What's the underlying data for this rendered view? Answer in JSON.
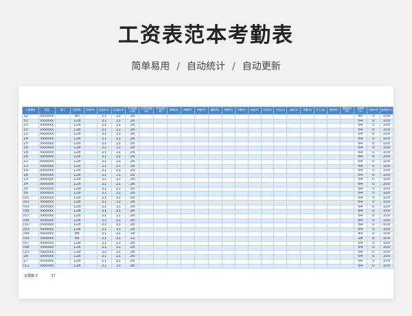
{
  "header": {
    "title": "工资表范本考勤表",
    "subtitle_items": [
      "简单易用",
      "自动统计",
      "自动更新"
    ],
    "separator": "/"
  },
  "table": {
    "columns": [
      "入职编号",
      "姓名",
      "部门",
      "应到(时)",
      "实到(时)",
      "应出勤(天)",
      "实出勤(天)",
      "平均出勤(小时)",
      "工作日加班(时)",
      "节日加班(时)",
      "事假(时)",
      "病假(时)",
      "年假(时)",
      "婚假(时)",
      "丧假(时)",
      "产假(时)",
      "出差(时)",
      "外出(时)",
      "外出(天)",
      "迟到(次)",
      "早退(次)",
      "旷工(次)",
      "缺勤(时)",
      "缺勤合计(时)",
      "出勤率(%)",
      "出勤小时",
      "出勤率(%)"
    ],
    "rows": [
      [
        "32",
        "xxxxxx",
        "",
        "80",
        "",
        "21",
        "21",
        "16",
        "",
        "",
        "",
        "",
        "",
        "",
        "",
        "",
        "",
        "",
        "",
        "",
        "",
        "",
        "",
        "",
        "40",
        "0",
        "100"
      ],
      [
        "31",
        "xxxxxx",
        "",
        "128",
        "",
        "21",
        "21",
        "26",
        "",
        "",
        "",
        "",
        "",
        "",
        "",
        "",
        "",
        "",
        "",
        "",
        "",
        "",
        "",
        "",
        "64",
        "0",
        "100"
      ],
      [
        "25",
        "xxxxxx",
        "",
        "128",
        "",
        "21",
        "21",
        "26",
        "",
        "",
        "",
        "",
        "",
        "",
        "",
        "",
        "",
        "",
        "",
        "",
        "",
        "",
        "",
        "",
        "64",
        "0",
        "100"
      ],
      [
        "10",
        "xxxxxx",
        "",
        "128",
        "",
        "21",
        "21",
        "26",
        "",
        "",
        "",
        "",
        "",
        "",
        "",
        "",
        "",
        "",
        "",
        "",
        "",
        "",
        "",
        "",
        "64",
        "0",
        "100"
      ],
      [
        "12",
        "xxxxxx",
        "",
        "128",
        "",
        "21",
        "21",
        "26",
        "",
        "",
        "",
        "",
        "",
        "",
        "",
        "",
        "",
        "",
        "",
        "",
        "",
        "",
        "",
        "",
        "64",
        "0",
        "100"
      ],
      [
        "14",
        "xxxxxx",
        "",
        "128",
        "",
        "21",
        "21",
        "26",
        "",
        "",
        "",
        "",
        "",
        "",
        "",
        "",
        "",
        "",
        "",
        "",
        "",
        "",
        "",
        "",
        "64",
        "0",
        "100"
      ],
      [
        "15",
        "xxxxxx",
        "",
        "128",
        "",
        "21",
        "21",
        "26",
        "",
        "",
        "",
        "",
        "",
        "",
        "",
        "",
        "",
        "",
        "",
        "",
        "",
        "",
        "",
        "",
        "64",
        "0",
        "100"
      ],
      [
        "16",
        "xxxxxx",
        "",
        "128",
        "",
        "21",
        "21",
        "26",
        "",
        "",
        "",
        "",
        "",
        "",
        "",
        "",
        "",
        "",
        "",
        "",
        "",
        "",
        "",
        "",
        "64",
        "0",
        "100"
      ],
      [
        "18",
        "xxxxxx",
        "",
        "128",
        "",
        "21",
        "21",
        "26",
        "",
        "",
        "",
        "",
        "",
        "",
        "",
        "",
        "",
        "",
        "",
        "",
        "",
        "",
        "",
        "",
        "64",
        "0",
        "100"
      ],
      [
        "19",
        "xxxxxx",
        "",
        "128",
        "",
        "21",
        "21",
        "26",
        "",
        "",
        "",
        "",
        "",
        "",
        "",
        "",
        "",
        "",
        "",
        "",
        "",
        "",
        "",
        "",
        "64",
        "0",
        "100"
      ],
      [
        "22",
        "xxxxxx",
        "",
        "128",
        "",
        "21",
        "21",
        "26",
        "",
        "",
        "",
        "",
        "",
        "",
        "",
        "",
        "",
        "",
        "",
        "",
        "",
        "",
        "",
        "",
        "64",
        "0",
        "100"
      ],
      [
        "13",
        "xxxxxx",
        "",
        "128",
        "",
        "21",
        "21",
        "26",
        "",
        "",
        "",
        "",
        "",
        "",
        "",
        "",
        "",
        "",
        "",
        "",
        "",
        "",
        "",
        "",
        "64",
        "0",
        "100"
      ],
      [
        "19",
        "xxxxxx",
        "",
        "128",
        "",
        "21",
        "21",
        "26",
        "",
        "",
        "",
        "",
        "",
        "",
        "",
        "",
        "",
        "",
        "",
        "",
        "",
        "",
        "",
        "",
        "64",
        "0",
        "100"
      ],
      [
        "18",
        "xxxxxx",
        "",
        "128",
        "",
        "21",
        "21",
        "26",
        "",
        "",
        "",
        "",
        "",
        "",
        "",
        "",
        "",
        "",
        "",
        "",
        "",
        "",
        "",
        "",
        "64",
        "0",
        "100"
      ],
      [
        "19",
        "xxxxxx",
        "",
        "128",
        "",
        "21",
        "21",
        "26",
        "",
        "",
        "",
        "",
        "",
        "",
        "",
        "",
        "",
        "",
        "",
        "",
        "",
        "",
        "",
        "",
        "64",
        "0",
        "100"
      ],
      [
        "34",
        "xxxxxx",
        "",
        "128",
        "",
        "21",
        "21",
        "26",
        "",
        "",
        "",
        "",
        "",
        "",
        "",
        "",
        "",
        "",
        "",
        "",
        "",
        "",
        "",
        "",
        "64",
        "0",
        "100"
      ],
      [
        "35",
        "xxxxxx",
        "",
        "128",
        "",
        "21",
        "21",
        "26",
        "",
        "",
        "",
        "",
        "",
        "",
        "",
        "",
        "",
        "",
        "",
        "",
        "",
        "",
        "",
        "",
        "64",
        "0",
        "100"
      ],
      [
        "36",
        "xxxxxx",
        "",
        "128",
        "",
        "21",
        "21",
        "26",
        "",
        "",
        "",
        "",
        "",
        "",
        "",
        "",
        "",
        "",
        "",
        "",
        "",
        "",
        "",
        "",
        "64",
        "0",
        "100"
      ],
      [
        "I01",
        "xxxxxx",
        "",
        "128",
        "",
        "21",
        "21",
        "26",
        "",
        "",
        "",
        "",
        "",
        "",
        "",
        "",
        "",
        "",
        "",
        "",
        "",
        "",
        "",
        "",
        "64",
        "0",
        "100"
      ],
      [
        "I02",
        "xxxxxx",
        "",
        "128",
        "",
        "21",
        "21",
        "26",
        "",
        "",
        "",
        "",
        "",
        "",
        "",
        "",
        "",
        "",
        "",
        "",
        "",
        "",
        "",
        "",
        "64",
        "0",
        "100"
      ],
      [
        "I03",
        "xxxxxx",
        "",
        "128",
        "",
        "21",
        "21",
        "26",
        "",
        "",
        "",
        "",
        "",
        "",
        "",
        "",
        "",
        "",
        "",
        "",
        "",
        "",
        "",
        "",
        "64",
        "0",
        "100"
      ],
      [
        "I05",
        "xxxxxx",
        "",
        "128",
        "",
        "21",
        "21",
        "26",
        "",
        "",
        "",
        "",
        "",
        "",
        "",
        "",
        "",
        "",
        "",
        "",
        "",
        "",
        "",
        "",
        "64",
        "0",
        "100"
      ],
      [
        "I07",
        "xxxxxx",
        "",
        "128",
        "",
        "21",
        "21",
        "26",
        "",
        "",
        "",
        "",
        "",
        "",
        "",
        "",
        "",
        "",
        "",
        "",
        "",
        "",
        "",
        "",
        "64",
        "0",
        "100"
      ],
      [
        "I08",
        "xxxxxx",
        "",
        "128",
        "",
        "21",
        "21",
        "26",
        "",
        "",
        "",
        "",
        "",
        "",
        "",
        "",
        "",
        "",
        "",
        "",
        "",
        "",
        "",
        "",
        "64",
        "0",
        "100"
      ],
      [
        "I10",
        "xxxxxx",
        "",
        "128",
        "",
        "21",
        "21",
        "26",
        "",
        "",
        "",
        "",
        "",
        "",
        "",
        "",
        "",
        "",
        "",
        "",
        "",
        "",
        "",
        "",
        "64",
        "0",
        "100"
      ],
      [
        "I03",
        "xxxxxx",
        "",
        "128",
        "",
        "21",
        "21",
        "26",
        "",
        "",
        "",
        "",
        "",
        "",
        "",
        "",
        "",
        "",
        "",
        "",
        "",
        "",
        "",
        "",
        "64",
        "0",
        "100"
      ],
      [
        "I04",
        "xxxxxx",
        "",
        "88",
        "",
        "21",
        "21",
        "18",
        "",
        "",
        "",
        "",
        "",
        "",
        "",
        "",
        "",
        "",
        "",
        "",
        "",
        "",
        "",
        "",
        "44",
        "0",
        "100"
      ],
      [
        "I03",
        "xxxxxx",
        "",
        "56",
        "",
        "21",
        "21",
        "12",
        "",
        "",
        "",
        "",
        "",
        "",
        "",
        "",
        "",
        "",
        "",
        "",
        "",
        "",
        "",
        "",
        "28",
        "0",
        "100"
      ],
      [
        "I07",
        "xxxxxx",
        "",
        "128",
        "",
        "21",
        "21",
        "26",
        "",
        "",
        "",
        "",
        "",
        "",
        "",
        "",
        "",
        "",
        "",
        "",
        "",
        "",
        "",
        "",
        "64",
        "0",
        "100"
      ],
      [
        "I08",
        "xxxxxx",
        "",
        "128",
        "",
        "21",
        "21",
        "26",
        "",
        "",
        "",
        "",
        "",
        "",
        "",
        "",
        "",
        "",
        "",
        "",
        "",
        "",
        "",
        "",
        "64",
        "0",
        "100"
      ],
      [
        "I10",
        "xxxxxx",
        "",
        "128",
        "",
        "21",
        "21",
        "26",
        "",
        "",
        "",
        "",
        "",
        "",
        "",
        "",
        "",
        "",
        "",
        "",
        "",
        "",
        "",
        "",
        "64",
        "0",
        "100"
      ],
      [
        "26",
        "xxxxxx",
        "",
        "128",
        "",
        "21",
        "21",
        "26",
        "",
        "",
        "",
        "",
        "",
        "",
        "",
        "",
        "",
        "",
        "",
        "",
        "",
        "",
        "",
        "",
        "64",
        "0",
        "100"
      ],
      [
        "27",
        "xxxxxx",
        "",
        "128",
        "",
        "21",
        "21",
        "26",
        "",
        "",
        "",
        "",
        "",
        "",
        "",
        "",
        "",
        "",
        "",
        "",
        "",
        "",
        "",
        "",
        "64",
        "0",
        "100"
      ],
      [
        "I11",
        "xxxxxx",
        "",
        "128",
        "",
        "21",
        "21",
        "26",
        "",
        "",
        "",
        "",
        "",
        "",
        "",
        "",
        "",
        "",
        "",
        "",
        "",
        "",
        "",
        "",
        "64",
        "0",
        "100"
      ]
    ]
  },
  "footer": {
    "label": "记录数:3",
    "value": "37"
  }
}
